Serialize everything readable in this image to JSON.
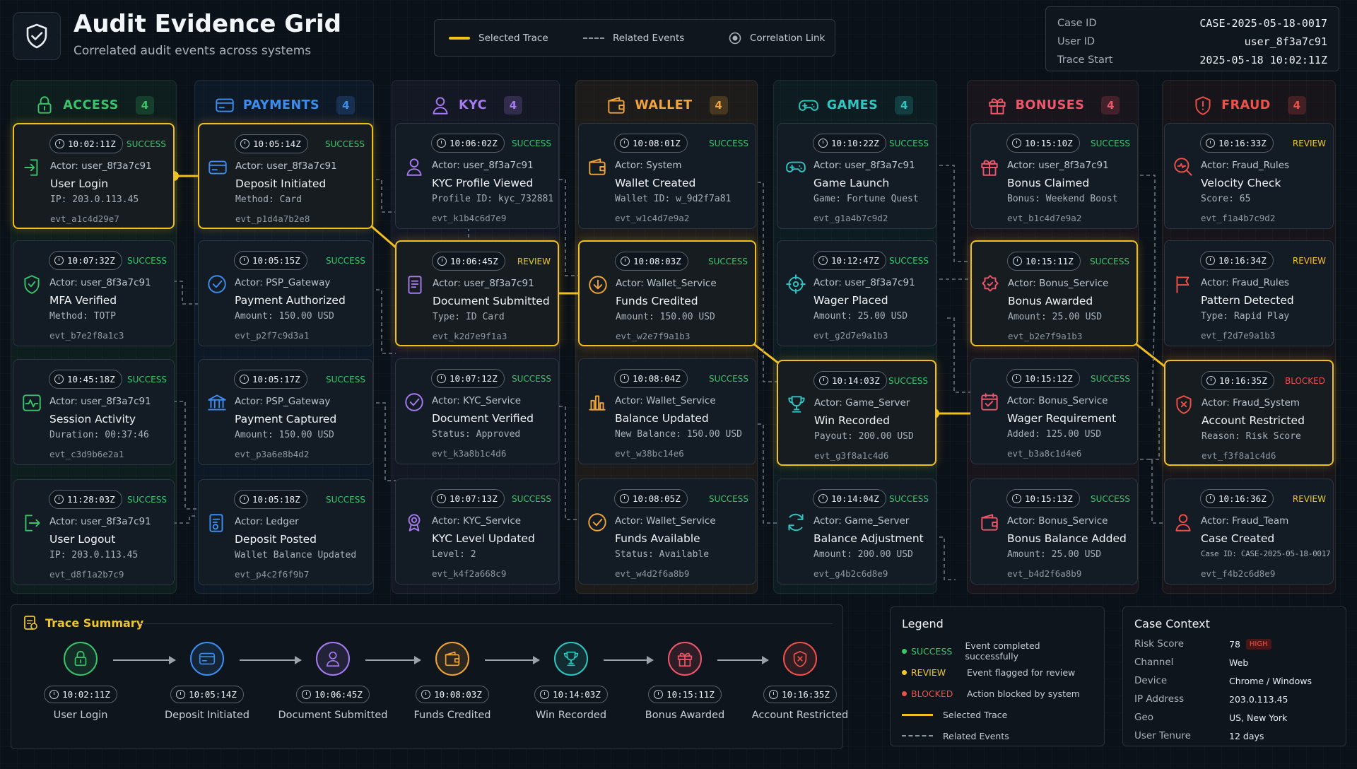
{
  "header": {
    "title": "Audit Evidence Grid",
    "subtitle": "Correlated audit events across systems"
  },
  "legend_top": {
    "selected": "Selected Trace",
    "related": "Related Events",
    "correlation": "Correlation Link"
  },
  "case": {
    "case_id_label": "Case ID",
    "case_id": "CASE-2025-05-18-0017",
    "user_id_label": "User ID",
    "user_id": "user_8f3a7c91",
    "trace_start_label": "Trace Start",
    "trace_start": "2025-05-18 10:02:11Z"
  },
  "colors": {
    "access": "#39c46a",
    "payments": "#3b8ef0",
    "kyc": "#a77bf0",
    "wallet": "#f0a43a",
    "games": "#2ec6c1",
    "bonuses": "#f0566b",
    "fraud": "#f0504a",
    "selected": "#f2c01c",
    "success": "#38c76b",
    "review": "#f0c62a",
    "blocked": "#f0504a"
  },
  "columns": [
    {
      "name": "ACCESS",
      "count": "4",
      "cards": [
        {
          "time": "10:02:11Z",
          "status": "SUCCESS",
          "actor": "Actor: user_8f3a7c91",
          "event": "User Login",
          "detail": "IP: 203.0.113.45",
          "id": "evt_a1c4d29e7",
          "icon": "login-icon"
        },
        {
          "time": "10:07:32Z",
          "status": "SUCCESS",
          "actor": "Actor: user_8f3a7c91",
          "event": "MFA Verified",
          "detail": "Method: TOTP",
          "id": "evt_b7e2f8a1c3",
          "icon": "shield-check-icon"
        },
        {
          "time": "10:45:18Z",
          "status": "SUCCESS",
          "actor": "Actor: user_8f3a7c91",
          "event": "Session Activity",
          "detail": "Duration: 00:37:46",
          "id": "evt_c3d9b6e2a1",
          "icon": "activity-icon"
        },
        {
          "time": "11:28:03Z",
          "status": "SUCCESS",
          "actor": "Actor: user_8f3a7c91",
          "event": "User Logout",
          "detail": "IP: 203.0.113.45",
          "id": "evt_d8f1a2b7c9",
          "icon": "logout-icon"
        }
      ]
    },
    {
      "name": "PAYMENTS",
      "count": "4",
      "cards": [
        {
          "time": "10:05:14Z",
          "status": "SUCCESS",
          "actor": "Actor: user_8f3a7c91",
          "event": "Deposit Initiated",
          "detail": "Method: Card",
          "id": "evt_p1d4a7b2e8",
          "icon": "card-icon"
        },
        {
          "time": "10:05:15Z",
          "status": "SUCCESS",
          "actor": "Actor: PSP_Gateway",
          "event": "Payment Authorized",
          "detail": "Amount: 150.00 USD",
          "id": "evt_p2f7c9d3a1",
          "icon": "check-circle-icon"
        },
        {
          "time": "10:05:17Z",
          "status": "SUCCESS",
          "actor": "Actor: PSP_Gateway",
          "event": "Payment Captured",
          "detail": "Amount: 150.00 USD",
          "id": "evt_p3a6e8b4d2",
          "icon": "bank-icon"
        },
        {
          "time": "10:05:18Z",
          "status": "SUCCESS",
          "actor": "Actor: Ledger",
          "event": "Deposit Posted",
          "detail": "Wallet Balance Updated",
          "id": "evt_p4c2f6f9b7",
          "icon": "ledger-icon"
        }
      ]
    },
    {
      "name": "KYC",
      "count": "4",
      "cards": [
        {
          "time": "10:06:02Z",
          "status": "SUCCESS",
          "actor": "Actor: user_8f3a7c91",
          "event": "KYC Profile Viewed",
          "detail": "Profile ID: kyc_732881",
          "id": "evt_k1b4c6d7e9",
          "icon": "user-icon"
        },
        {
          "time": "10:06:45Z",
          "status": "REVIEW",
          "actor": "Actor: user_8f3a7c91",
          "event": "Document Submitted",
          "detail": "Type: ID Card",
          "id": "evt_k2d7e9f1a3",
          "icon": "document-icon"
        },
        {
          "time": "10:07:12Z",
          "status": "SUCCESS",
          "actor": "Actor: KYC_Service",
          "event": "Document Verified",
          "detail": "Status: Approved",
          "id": "evt_k3a8b1c4d6",
          "icon": "check-circle-icon"
        },
        {
          "time": "10:07:13Z",
          "status": "SUCCESS",
          "actor": "Actor: KYC_Service",
          "event": "KYC Level Updated",
          "detail": "Level: 2",
          "id": "evt_k4f2a668c9",
          "icon": "award-icon"
        }
      ]
    },
    {
      "name": "WALLET",
      "count": "4",
      "cards": [
        {
          "time": "10:08:01Z",
          "status": "SUCCESS",
          "actor": "Actor: System",
          "event": "Wallet Created",
          "detail": "Wallet ID: w_9d2f7a81",
          "id": "evt_w1c4d7e9a2",
          "icon": "wallet-icon"
        },
        {
          "time": "10:08:03Z",
          "status": "SUCCESS",
          "actor": "Actor: Wallet_Service",
          "event": "Funds Credited",
          "detail": "Amount: 150.00 USD",
          "id": "evt_w2e7f9a1b3",
          "icon": "download-circle-icon"
        },
        {
          "time": "10:08:04Z",
          "status": "SUCCESS",
          "actor": "Actor: Wallet_Service",
          "event": "Balance Updated",
          "detail": "New Balance: 150.00 USD",
          "id": "evt_w38bc14e6",
          "icon": "bar-chart-icon"
        },
        {
          "time": "10:08:05Z",
          "status": "SUCCESS",
          "actor": "Actor: Wallet_Service",
          "event": "Funds Available",
          "detail": "Status: Available",
          "id": "evt_w4d2f6a8b9",
          "icon": "check-circle-icon"
        }
      ]
    },
    {
      "name": "GAMES",
      "count": "4",
      "cards": [
        {
          "time": "10:10:22Z",
          "status": "SUCCESS",
          "actor": "Actor: user_8f3a7c91",
          "event": "Game Launch",
          "detail": "Game: Fortune Quest",
          "id": "evt_g1a4b7c9d2",
          "icon": "gamepad-icon"
        },
        {
          "time": "10:12:47Z",
          "status": "SUCCESS",
          "actor": "Actor: user_8f3a7c91",
          "event": "Wager Placed",
          "detail": "Amount: 25.00 USD",
          "id": "evt_g2d7e9a1b3",
          "icon": "target-icon"
        },
        {
          "time": "10:14:03Z",
          "status": "SUCCESS",
          "actor": "Actor: Game_Server",
          "event": "Win Recorded",
          "detail": "Payout: 200.00 USD",
          "id": "evt_g3f8a1c4d6",
          "icon": "trophy-icon"
        },
        {
          "time": "10:14:04Z",
          "status": "SUCCESS",
          "actor": "Actor: Game_Server",
          "event": "Balance Adjustment",
          "detail": "Amount: 200.00 USD",
          "id": "evt_g4b2c6d8e9",
          "icon": "refresh-icon"
        }
      ]
    },
    {
      "name": "BONUSES",
      "count": "4",
      "cards": [
        {
          "time": "10:15:10Z",
          "status": "SUCCESS",
          "actor": "Actor: user_8f3a7c91",
          "event": "Bonus Claimed",
          "detail": "Bonus: Weekend Boost",
          "id": "evt_b1c4d7e9a2",
          "icon": "gift-icon"
        },
        {
          "time": "10:15:11Z",
          "status": "SUCCESS",
          "actor": "Actor: Bonus_Service",
          "event": "Bonus Awarded",
          "detail": "Amount: 25.00 USD",
          "id": "evt_b2e7f9a1b3",
          "icon": "badge-icon"
        },
        {
          "time": "10:15:12Z",
          "status": "SUCCESS",
          "actor": "Actor: Bonus_Service",
          "event": "Wager Requirement",
          "detail": "Added: 125.00 USD",
          "id": "evt_b3a8c1d4e6",
          "icon": "calendar-check-icon"
        },
        {
          "time": "10:15:13Z",
          "status": "SUCCESS",
          "actor": "Actor: Bonus_Service",
          "event": "Bonus Balance Added",
          "detail": "Amount: 25.00 USD",
          "id": "evt_b4d2f6a8b9",
          "icon": "wallet-icon"
        }
      ]
    },
    {
      "name": "FRAUD",
      "count": "4",
      "cards": [
        {
          "time": "10:16:33Z",
          "status": "REVIEW",
          "actor": "Actor: Fraud_Rules",
          "event": "Velocity Check",
          "detail": "Score: 65",
          "id": "evt_f1a4b7c9d2",
          "icon": "search-activity-icon"
        },
        {
          "time": "10:16:34Z",
          "status": "REVIEW",
          "actor": "Actor: Fraud_Rules",
          "event": "Pattern Detected",
          "detail": "Type: Rapid Play",
          "id": "evt_f2d7e9a1b3",
          "icon": "flag-icon"
        },
        {
          "time": "10:16:35Z",
          "status": "BLOCKED",
          "actor": "Actor: Fraud_System",
          "event": "Account Restricted",
          "detail": "Reason: Risk Score",
          "id": "evt_f3f8a1c4d6",
          "icon": "shield-x-icon"
        },
        {
          "time": "10:16:36Z",
          "status": "REVIEW",
          "actor": "Actor: Fraud_Team",
          "event": "Case Created",
          "detail": "Case ID: CASE-2025-05-18-0017",
          "id": "evt_f4b2c6d8e9",
          "icon": "user-icon"
        }
      ]
    }
  ],
  "trace_summary": {
    "title": "Trace Summary",
    "steps": [
      {
        "time": "10:02:11Z",
        "label": "User Login",
        "icon": "lock-icon"
      },
      {
        "time": "10:05:14Z",
        "label": "Deposit Initiated",
        "icon": "card-icon"
      },
      {
        "time": "10:06:45Z",
        "label": "Document Submitted",
        "icon": "user-icon"
      },
      {
        "time": "10:08:03Z",
        "label": "Funds Credited",
        "icon": "wallet-icon"
      },
      {
        "time": "10:14:03Z",
        "label": "Win Recorded",
        "icon": "trophy-icon"
      },
      {
        "time": "10:15:11Z",
        "label": "Bonus Awarded",
        "icon": "gift-icon"
      },
      {
        "time": "10:16:35Z",
        "label": "Account Restricted",
        "icon": "shield-x-icon"
      }
    ]
  },
  "legend": {
    "title": "Legend",
    "success_key": "SUCCESS",
    "success_desc": "Event completed successfully",
    "review_key": "REVIEW",
    "review_desc": "Event flagged for review",
    "blocked_key": "BLOCKED",
    "blocked_desc": "Action blocked by system",
    "selected_desc": "Selected Trace",
    "related_desc": "Related Events"
  },
  "case_context": {
    "title": "Case Context",
    "rows": [
      {
        "k": "Risk Score",
        "v": "78",
        "badge": "HIGH"
      },
      {
        "k": "Channel",
        "v": "Web"
      },
      {
        "k": "Device",
        "v": "Chrome / Windows"
      },
      {
        "k": "IP Address",
        "v": "203.0.113.45"
      },
      {
        "k": "Geo",
        "v": "US, New York"
      },
      {
        "k": "User Tenure",
        "v": "12 days"
      }
    ]
  }
}
